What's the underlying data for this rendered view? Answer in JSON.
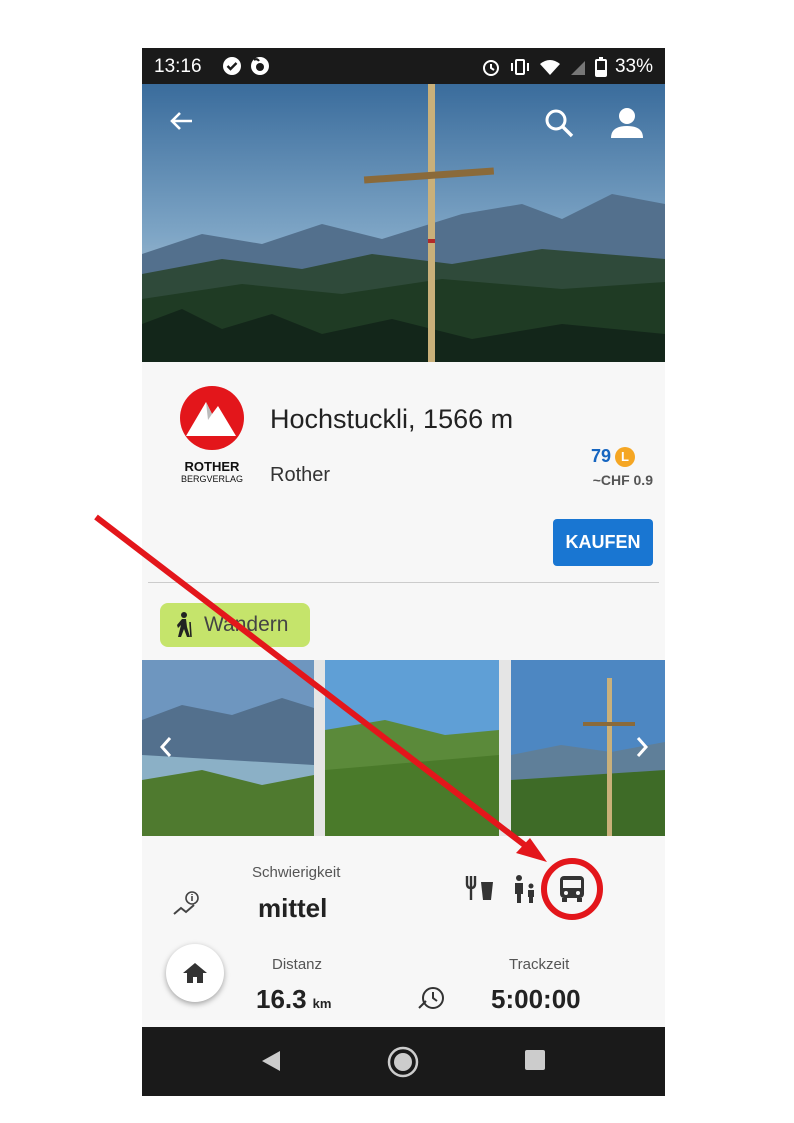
{
  "status_bar": {
    "time": "13:16",
    "battery": "33%"
  },
  "hero": {
    "icons": [
      "back-arrow-icon",
      "search-icon",
      "account-icon"
    ]
  },
  "listing": {
    "title": "Hochstuckli, 1566 m",
    "publisher": "Rother",
    "logo_line1": "ROTHER",
    "logo_line2": "BERGVERLAG",
    "price_points": "79",
    "points_symbol": "L",
    "price_chf": "~CHF 0.9",
    "buy_label": "KAUFEN"
  },
  "activity": {
    "label": "Wandern"
  },
  "gallery": {
    "photos": 3,
    "icons": [
      "chevron-left-icon",
      "chevron-right-icon"
    ]
  },
  "stats": {
    "difficulty_label": "Schwierigkeit",
    "difficulty_value": "mittel",
    "distance_label": "Distanz",
    "distance_value": "16.3",
    "distance_unit": "km",
    "tracktime_label": "Trackzeit",
    "tracktime_value": "5:00:00",
    "feature_icons": [
      "restaurant-icon",
      "family-icon",
      "bus-icon"
    ]
  },
  "annotation": {
    "arrow_color": "#e3161b",
    "highlighted": "bus-icon"
  },
  "colors": {
    "accent": "#1976d2",
    "chip": "#c5e46b",
    "statusbar": "#1a1a1a"
  }
}
